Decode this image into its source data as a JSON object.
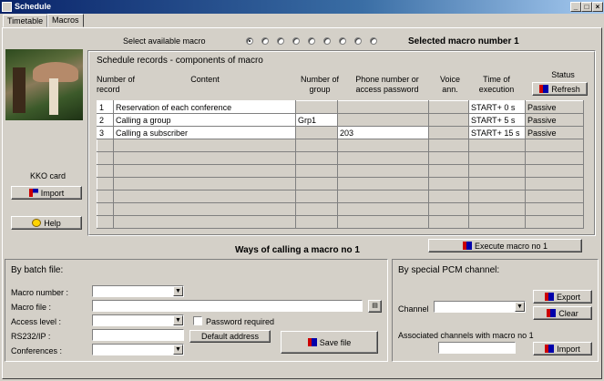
{
  "window": {
    "title": "Schedule"
  },
  "tabs": [
    {
      "label": "Timetable"
    },
    {
      "label": "Macros"
    }
  ],
  "macro_select": {
    "label": "Select available macro",
    "selected_text": "Selected macro number 1",
    "selected_index": 0,
    "count": 9
  },
  "left": {
    "card_label": "KKO card",
    "import_label": "Import",
    "help_label": "Help"
  },
  "records": {
    "title": "Schedule records  - components of macro",
    "headers": {
      "number": "Number of record",
      "content": "Content",
      "group": "Number of group",
      "phone": "Phone number or access password",
      "voice": "Voice ann.",
      "time": "Time of execution",
      "status": "Status"
    },
    "refresh_label": "Refresh",
    "rows": [
      {
        "num": "1",
        "content": "Reservation of each conference",
        "group": "",
        "phone": "",
        "voice": "",
        "time": "START+ 0 s",
        "status": "Passive"
      },
      {
        "num": "2",
        "content": "Calling a group",
        "group": "Grp1",
        "phone": "",
        "voice": "",
        "time": "START+ 5 s",
        "status": "Passive"
      },
      {
        "num": "3",
        "content": "Calling a subscriber",
        "group": "",
        "phone": "203",
        "voice": "",
        "time": "START+ 15 s",
        "status": "Passive"
      },
      {
        "num": "",
        "content": "",
        "group": "",
        "phone": "",
        "voice": "",
        "time": "",
        "status": ""
      },
      {
        "num": "",
        "content": "",
        "group": "",
        "phone": "",
        "voice": "",
        "time": "",
        "status": ""
      },
      {
        "num": "",
        "content": "",
        "group": "",
        "phone": "",
        "voice": "",
        "time": "",
        "status": ""
      },
      {
        "num": "",
        "content": "",
        "group": "",
        "phone": "",
        "voice": "",
        "time": "",
        "status": ""
      },
      {
        "num": "",
        "content": "",
        "group": "",
        "phone": "",
        "voice": "",
        "time": "",
        "status": ""
      },
      {
        "num": "",
        "content": "",
        "group": "",
        "phone": "",
        "voice": "",
        "time": "",
        "status": ""
      },
      {
        "num": "",
        "content": "",
        "group": "",
        "phone": "",
        "voice": "",
        "time": "",
        "status": ""
      }
    ]
  },
  "ways": {
    "title": "Ways of calling a macro no 1",
    "execute_label": "Execute macro no 1"
  },
  "batch": {
    "title": "By batch file:",
    "macro_number_label": "Macro number :",
    "macro_file_label": "Macro file :",
    "access_level_label": "Access level :",
    "password_required_label": "Password required",
    "rs232_label": "RS232/IP :",
    "default_address_label": "Default address",
    "conferences_label": "Conferences :",
    "save_file_label": "Save file"
  },
  "pcm": {
    "title": "By special PCM channel:",
    "channel_label": "Channel",
    "export_label": "Export",
    "clear_label": "Clear",
    "assoc_label": "Associated channels with macro no 1",
    "import_label": "Import"
  }
}
